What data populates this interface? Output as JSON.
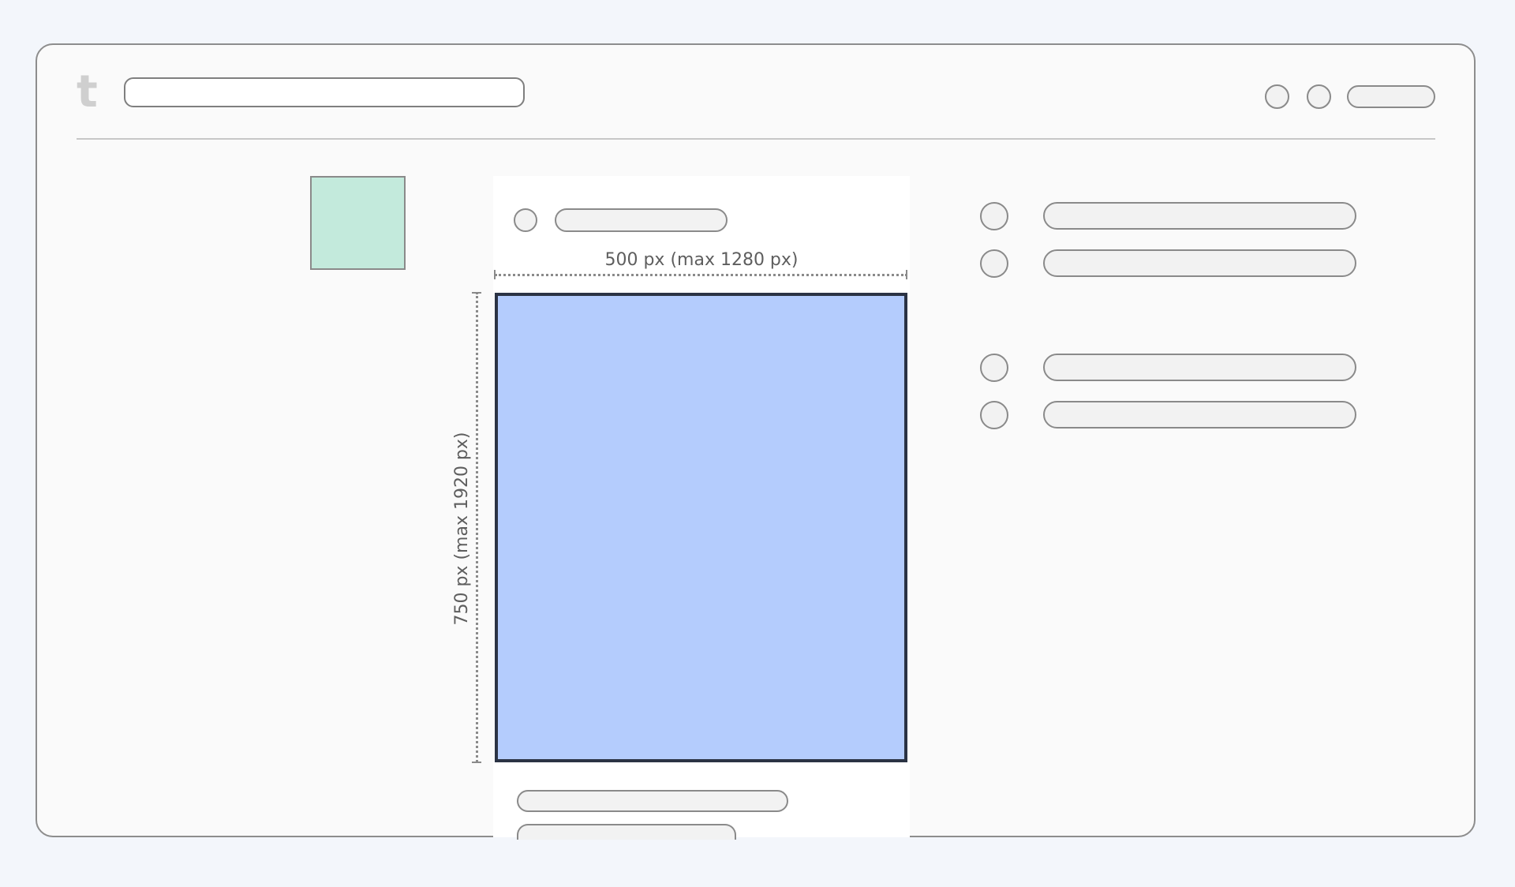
{
  "header": {
    "logo_text": "t",
    "logo_icon": "tumblr-logo-icon"
  },
  "post": {
    "width_annotation": "500 px (max 1280 px)",
    "height_annotation": "750 px (max 1920 px)"
  },
  "colors": {
    "background": "#f3f6fb",
    "frame": "#fafafa",
    "avatar_fill": "#c3eadc",
    "media_fill": "#b4ccfd",
    "media_border": "#2b3344",
    "placeholder_fill": "#f2f2f2",
    "outline": "#8a8a8a"
  }
}
